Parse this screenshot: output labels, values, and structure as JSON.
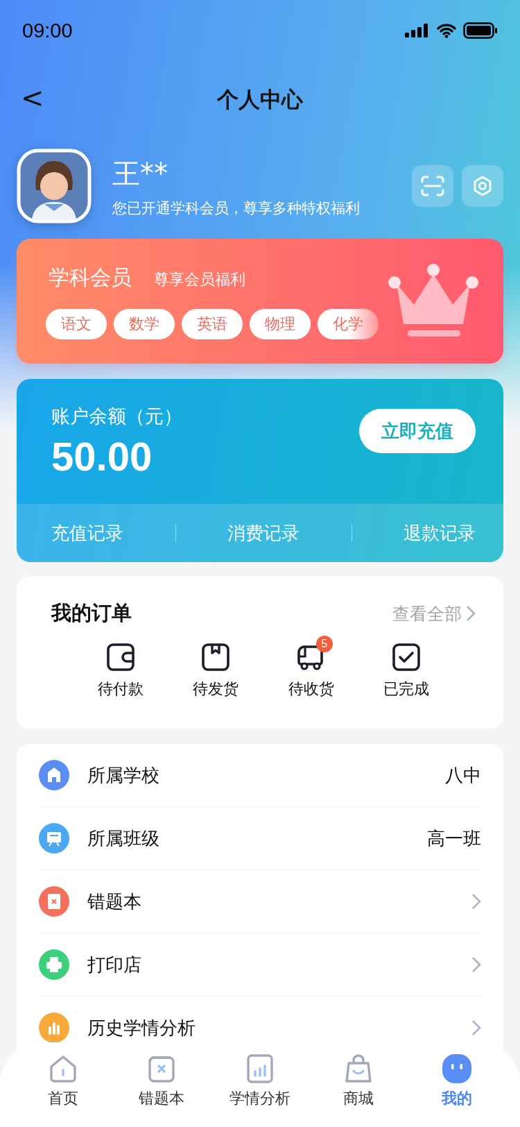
{
  "status_bar": {
    "time": "09:00"
  },
  "header": {
    "back": "<",
    "title": "个人中心"
  },
  "profile": {
    "name": "王**",
    "subtitle": "您已开通学科会员，尊享多种特权福利"
  },
  "member_card": {
    "title": "学科会员",
    "subtitle": "尊享会员福利",
    "tags": [
      "语文",
      "数学",
      "英语",
      "物理",
      "化学"
    ]
  },
  "balance_card": {
    "label": "账户余额（元）",
    "amount": "50.00",
    "button": "立即充值",
    "links": [
      "充值记录",
      "消费记录",
      "退款记录"
    ]
  },
  "orders": {
    "title": "我的订单",
    "view_all": "查看全部",
    "items": [
      {
        "kind": "wallet",
        "label": "待付款"
      },
      {
        "kind": "box",
        "label": "待发货"
      },
      {
        "kind": "truck",
        "label": "待收货",
        "badge": "5"
      },
      {
        "kind": "done",
        "label": "已完成"
      }
    ]
  },
  "menu": [
    {
      "kind": "value",
      "label": "所属学校",
      "value": "八中",
      "color": "#5b8ef5"
    },
    {
      "kind": "value",
      "label": "所属班级",
      "value": "高一班",
      "color": "#4aa9f2"
    },
    {
      "kind": "link",
      "label": "错题本",
      "color": "#f2705c"
    },
    {
      "kind": "link",
      "label": "打印店",
      "color": "#3ecf7c"
    },
    {
      "kind": "link",
      "label": "历史学情分析",
      "color": "#f7a93a"
    }
  ],
  "tabs": [
    {
      "label": "首页",
      "selected": false
    },
    {
      "label": "错题本",
      "selected": false
    },
    {
      "label": "学情分析",
      "selected": false
    },
    {
      "label": "商城",
      "selected": false
    },
    {
      "label": "我的",
      "selected": true
    }
  ]
}
